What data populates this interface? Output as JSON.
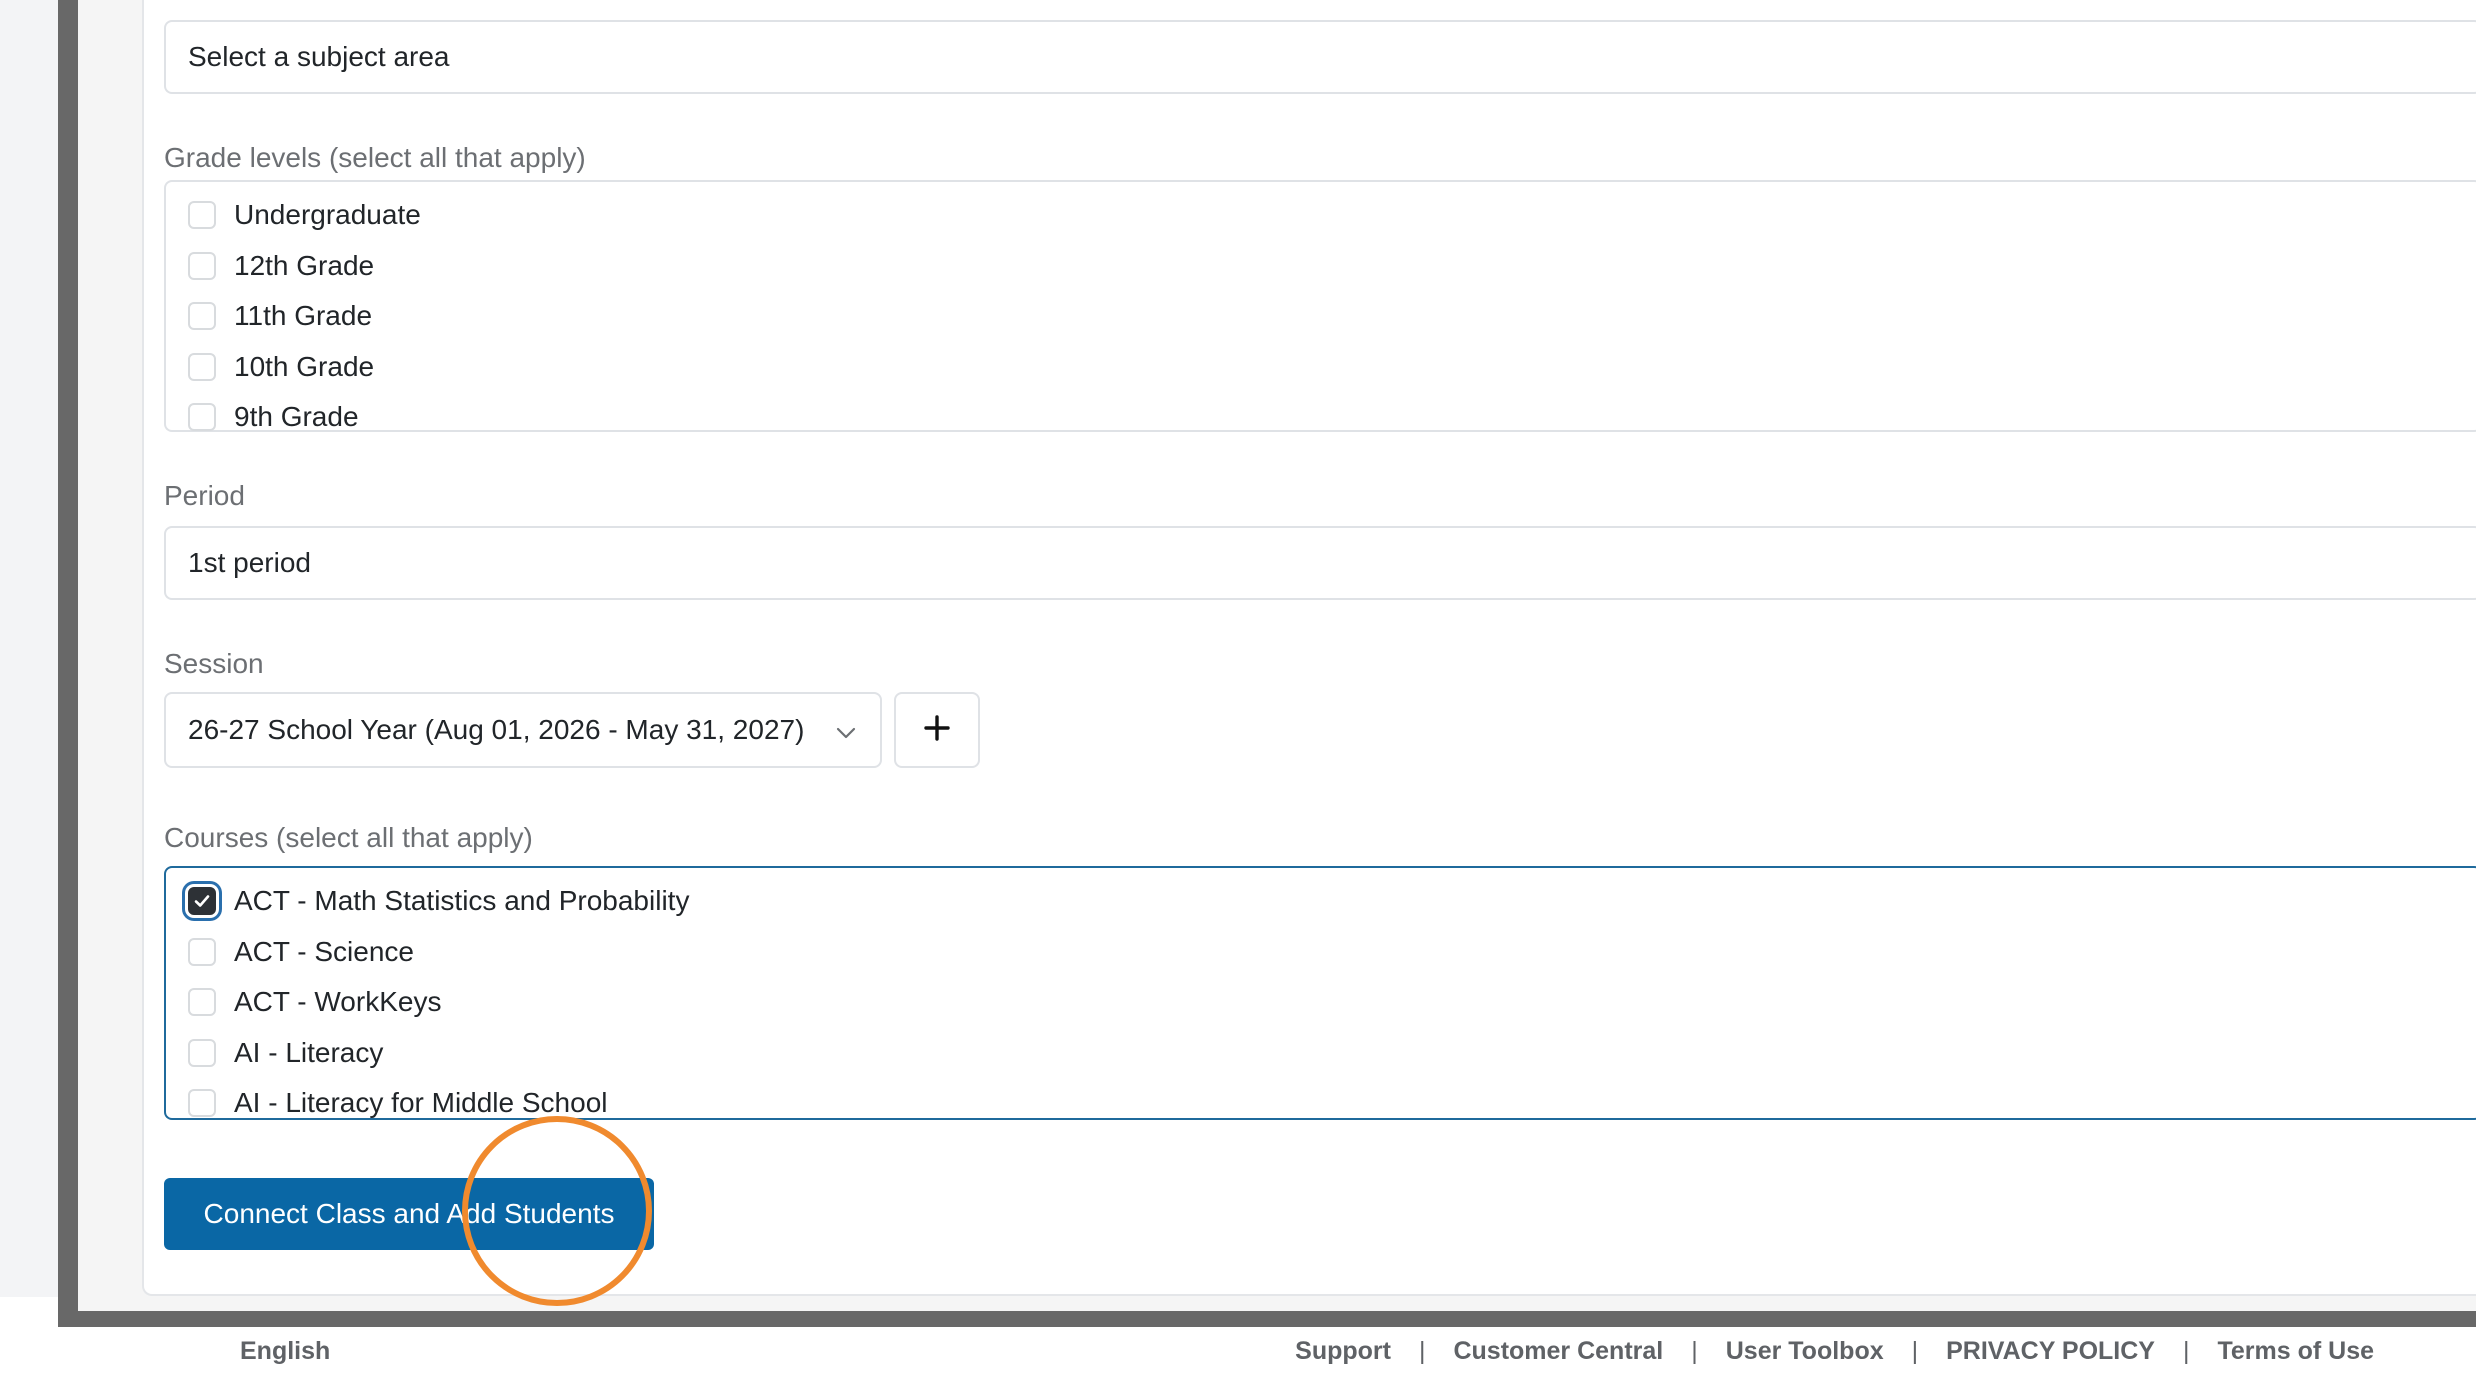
{
  "form": {
    "subject": {
      "value": "Select a subject area"
    },
    "grade_levels": {
      "label": "Grade levels (select all that apply)",
      "options": [
        {
          "label": "Undergraduate",
          "checked": false
        },
        {
          "label": "12th Grade",
          "checked": false
        },
        {
          "label": "11th Grade",
          "checked": false
        },
        {
          "label": "10th Grade",
          "checked": false
        },
        {
          "label": "9th Grade",
          "checked": false
        }
      ]
    },
    "period": {
      "label": "Period",
      "value": "1st period"
    },
    "session": {
      "label": "Session",
      "value": "26-27 School Year (Aug 01, 2026 - May 31, 2027)",
      "add_label": "+"
    },
    "courses": {
      "label": "Courses (select all that apply)",
      "options": [
        {
          "label": "ACT - Math Statistics and Probability",
          "checked": true
        },
        {
          "label": "ACT - Science",
          "checked": false
        },
        {
          "label": "ACT - WorkKeys",
          "checked": false
        },
        {
          "label": "AI - Literacy",
          "checked": false
        },
        {
          "label": "AI - Literacy for Middle School",
          "checked": false
        }
      ]
    },
    "submit_label": "Connect Class and Add Students"
  },
  "footer": {
    "language": "English",
    "links": [
      "Support",
      "Customer Central",
      "User Toolbox",
      "PRIVACY POLICY",
      "Terms of Use"
    ],
    "separator": "|"
  },
  "colors": {
    "primary": "#0a67a5",
    "highlight": "#f08a2e",
    "focus_border": "#1f6a9c"
  }
}
